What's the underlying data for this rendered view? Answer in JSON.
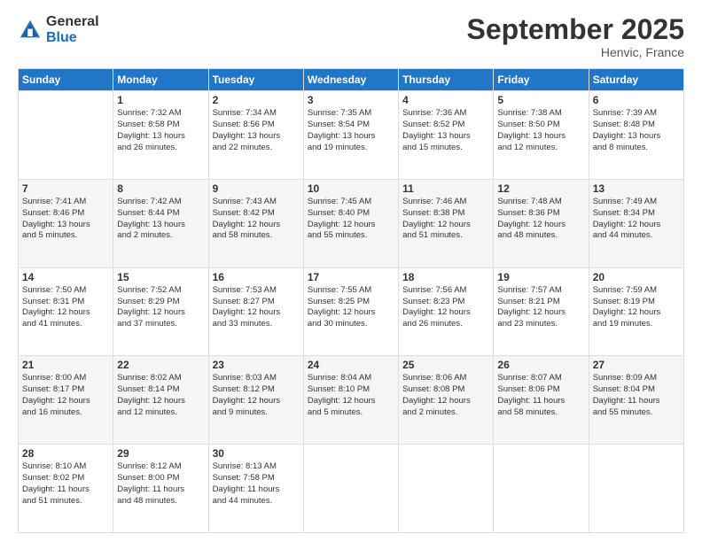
{
  "logo": {
    "general": "General",
    "blue": "Blue"
  },
  "title": "September 2025",
  "location": "Henvic, France",
  "days_of_week": [
    "Sunday",
    "Monday",
    "Tuesday",
    "Wednesday",
    "Thursday",
    "Friday",
    "Saturday"
  ],
  "weeks": [
    [
      {
        "day": "",
        "info": ""
      },
      {
        "day": "1",
        "info": "Sunrise: 7:32 AM\nSunset: 8:58 PM\nDaylight: 13 hours\nand 26 minutes."
      },
      {
        "day": "2",
        "info": "Sunrise: 7:34 AM\nSunset: 8:56 PM\nDaylight: 13 hours\nand 22 minutes."
      },
      {
        "day": "3",
        "info": "Sunrise: 7:35 AM\nSunset: 8:54 PM\nDaylight: 13 hours\nand 19 minutes."
      },
      {
        "day": "4",
        "info": "Sunrise: 7:36 AM\nSunset: 8:52 PM\nDaylight: 13 hours\nand 15 minutes."
      },
      {
        "day": "5",
        "info": "Sunrise: 7:38 AM\nSunset: 8:50 PM\nDaylight: 13 hours\nand 12 minutes."
      },
      {
        "day": "6",
        "info": "Sunrise: 7:39 AM\nSunset: 8:48 PM\nDaylight: 13 hours\nand 8 minutes."
      }
    ],
    [
      {
        "day": "7",
        "info": "Sunrise: 7:41 AM\nSunset: 8:46 PM\nDaylight: 13 hours\nand 5 minutes."
      },
      {
        "day": "8",
        "info": "Sunrise: 7:42 AM\nSunset: 8:44 PM\nDaylight: 13 hours\nand 2 minutes."
      },
      {
        "day": "9",
        "info": "Sunrise: 7:43 AM\nSunset: 8:42 PM\nDaylight: 12 hours\nand 58 minutes."
      },
      {
        "day": "10",
        "info": "Sunrise: 7:45 AM\nSunset: 8:40 PM\nDaylight: 12 hours\nand 55 minutes."
      },
      {
        "day": "11",
        "info": "Sunrise: 7:46 AM\nSunset: 8:38 PM\nDaylight: 12 hours\nand 51 minutes."
      },
      {
        "day": "12",
        "info": "Sunrise: 7:48 AM\nSunset: 8:36 PM\nDaylight: 12 hours\nand 48 minutes."
      },
      {
        "day": "13",
        "info": "Sunrise: 7:49 AM\nSunset: 8:34 PM\nDaylight: 12 hours\nand 44 minutes."
      }
    ],
    [
      {
        "day": "14",
        "info": "Sunrise: 7:50 AM\nSunset: 8:31 PM\nDaylight: 12 hours\nand 41 minutes."
      },
      {
        "day": "15",
        "info": "Sunrise: 7:52 AM\nSunset: 8:29 PM\nDaylight: 12 hours\nand 37 minutes."
      },
      {
        "day": "16",
        "info": "Sunrise: 7:53 AM\nSunset: 8:27 PM\nDaylight: 12 hours\nand 33 minutes."
      },
      {
        "day": "17",
        "info": "Sunrise: 7:55 AM\nSunset: 8:25 PM\nDaylight: 12 hours\nand 30 minutes."
      },
      {
        "day": "18",
        "info": "Sunrise: 7:56 AM\nSunset: 8:23 PM\nDaylight: 12 hours\nand 26 minutes."
      },
      {
        "day": "19",
        "info": "Sunrise: 7:57 AM\nSunset: 8:21 PM\nDaylight: 12 hours\nand 23 minutes."
      },
      {
        "day": "20",
        "info": "Sunrise: 7:59 AM\nSunset: 8:19 PM\nDaylight: 12 hours\nand 19 minutes."
      }
    ],
    [
      {
        "day": "21",
        "info": "Sunrise: 8:00 AM\nSunset: 8:17 PM\nDaylight: 12 hours\nand 16 minutes."
      },
      {
        "day": "22",
        "info": "Sunrise: 8:02 AM\nSunset: 8:14 PM\nDaylight: 12 hours\nand 12 minutes."
      },
      {
        "day": "23",
        "info": "Sunrise: 8:03 AM\nSunset: 8:12 PM\nDaylight: 12 hours\nand 9 minutes."
      },
      {
        "day": "24",
        "info": "Sunrise: 8:04 AM\nSunset: 8:10 PM\nDaylight: 12 hours\nand 5 minutes."
      },
      {
        "day": "25",
        "info": "Sunrise: 8:06 AM\nSunset: 8:08 PM\nDaylight: 12 hours\nand 2 minutes."
      },
      {
        "day": "26",
        "info": "Sunrise: 8:07 AM\nSunset: 8:06 PM\nDaylight: 11 hours\nand 58 minutes."
      },
      {
        "day": "27",
        "info": "Sunrise: 8:09 AM\nSunset: 8:04 PM\nDaylight: 11 hours\nand 55 minutes."
      }
    ],
    [
      {
        "day": "28",
        "info": "Sunrise: 8:10 AM\nSunset: 8:02 PM\nDaylight: 11 hours\nand 51 minutes."
      },
      {
        "day": "29",
        "info": "Sunrise: 8:12 AM\nSunset: 8:00 PM\nDaylight: 11 hours\nand 48 minutes."
      },
      {
        "day": "30",
        "info": "Sunrise: 8:13 AM\nSunset: 7:58 PM\nDaylight: 11 hours\nand 44 minutes."
      },
      {
        "day": "",
        "info": ""
      },
      {
        "day": "",
        "info": ""
      },
      {
        "day": "",
        "info": ""
      },
      {
        "day": "",
        "info": ""
      }
    ]
  ]
}
